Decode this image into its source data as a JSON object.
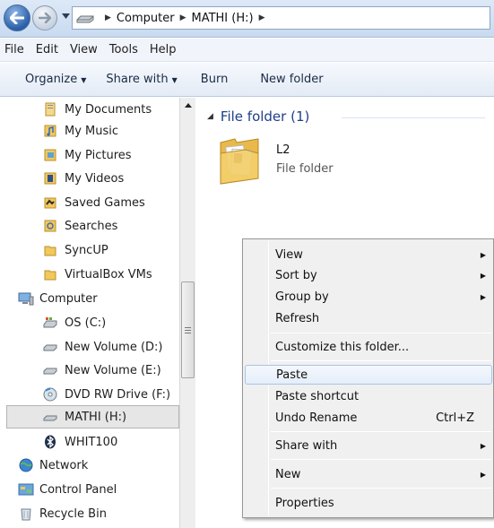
{
  "address": {
    "breadcrumbs": [
      "Computer",
      "MATHI (H:)"
    ]
  },
  "menubar": [
    "File",
    "Edit",
    "View",
    "Tools",
    "Help"
  ],
  "toolbar": {
    "organize": "Organize",
    "share_with": "Share with",
    "burn": "Burn",
    "new_folder": "New folder"
  },
  "navpane": {
    "items": [
      {
        "label": "My Documents",
        "icon": "documents-folder-icon"
      },
      {
        "label": "My Music",
        "icon": "music-folder-icon"
      },
      {
        "label": "My Pictures",
        "icon": "pictures-folder-icon"
      },
      {
        "label": "My Videos",
        "icon": "videos-folder-icon"
      },
      {
        "label": "Saved Games",
        "icon": "saved-games-icon"
      },
      {
        "label": "Searches",
        "icon": "searches-icon"
      },
      {
        "label": "SyncUP",
        "icon": "folder-icon"
      },
      {
        "label": "VirtualBox VMs",
        "icon": "folder-icon"
      },
      {
        "label": "Computer",
        "icon": "computer-icon"
      },
      {
        "label": "OS (C:)",
        "icon": "system-drive-icon"
      },
      {
        "label": "New Volume (D:)",
        "icon": "drive-icon"
      },
      {
        "label": "New Volume (E:)",
        "icon": "drive-icon"
      },
      {
        "label": "DVD RW Drive (F:)",
        "icon": "dvd-drive-icon"
      },
      {
        "label": "MATHI (H:)",
        "icon": "removable-drive-icon",
        "selected": true
      },
      {
        "label": "WHIT100",
        "icon": "bluetooth-icon"
      },
      {
        "label": "Network",
        "icon": "network-icon"
      },
      {
        "label": "Control Panel",
        "icon": "control-panel-icon"
      },
      {
        "label": "Recycle Bin",
        "icon": "recycle-bin-icon"
      }
    ]
  },
  "content": {
    "group_header": "File folder (1)",
    "items": [
      {
        "name": "L2",
        "type": "File folder"
      }
    ]
  },
  "context_menu": {
    "view": "View",
    "sort_by": "Sort by",
    "group_by": "Group by",
    "refresh": "Refresh",
    "customize": "Customize this folder...",
    "paste": "Paste",
    "paste_shortcut": "Paste shortcut",
    "undo_rename": "Undo Rename",
    "undo_shortcut": "Ctrl+Z",
    "share_with": "Share with",
    "new": "New",
    "properties": "Properties"
  },
  "colors": {
    "accent": "#1e3f87",
    "selection": "#e6e6e6",
    "folder": "#f2c75c"
  }
}
